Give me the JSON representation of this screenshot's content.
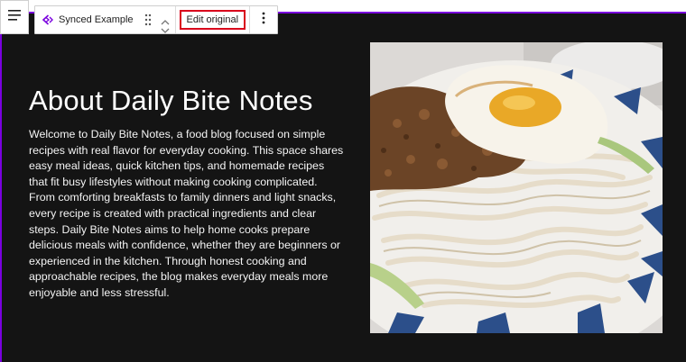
{
  "toolbar": {
    "block_name": "Synced Example",
    "edit_original_label": "Edit original",
    "icons": {
      "menu": "menu-icon",
      "block": "synced-pattern-icon",
      "drag": "drag-handle-icon",
      "move_up": "chevron-up-icon",
      "move_down": "chevron-down-icon",
      "more": "more-options-icon"
    }
  },
  "content": {
    "heading": "About Daily Bite Notes",
    "body": "Welcome to Daily Bite Notes, a food blog focused on simple recipes with real flavor for everyday cooking. This space shares easy meal ideas, quick kitchen tips, and homemade recipes that fit busy lifestyles without making cooking complicated. From comforting breakfasts to family dinners and light snacks, every recipe is created with practical ingredients and clear steps. Daily Bite Notes aims to help home cooks prepare delicious meals with confidence, whether they are beginners or experienced in the kitchen. Through honest cooking and approachable recipes, the blog makes everyday meals more enjoyable and less stressful."
  },
  "colors": {
    "canvas_background": "#141414",
    "synced_accent": "#7a00df",
    "highlight_border": "#d9001b",
    "text": "#ffffff"
  }
}
